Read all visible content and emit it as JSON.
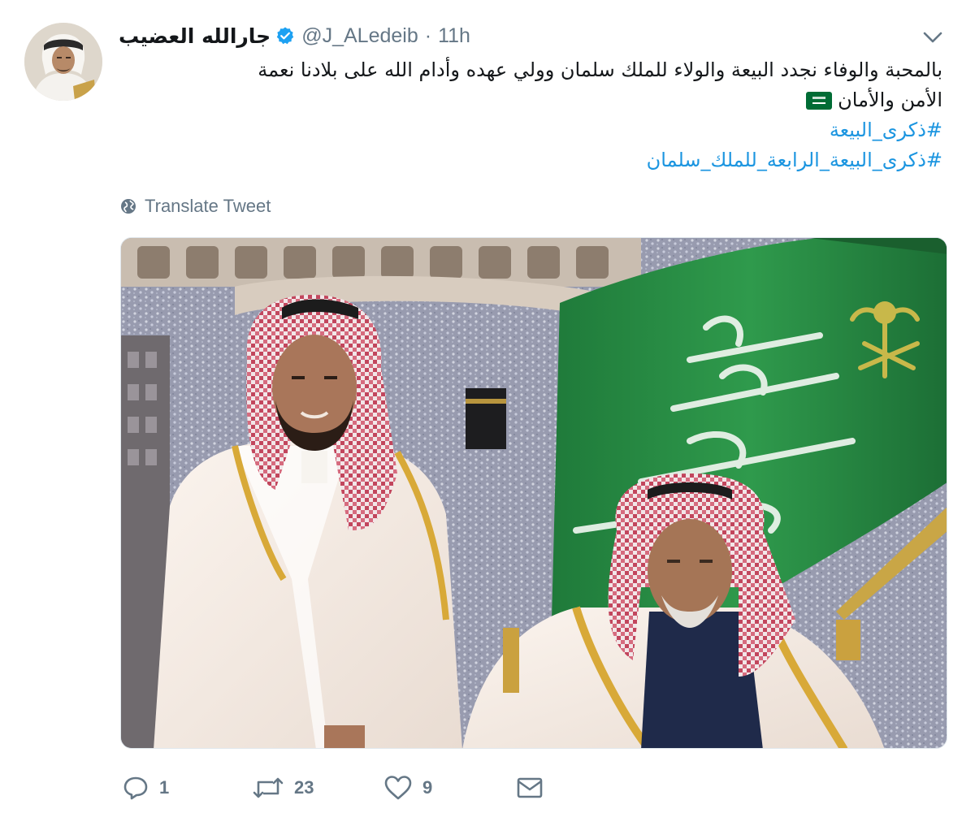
{
  "tweet": {
    "author_name": "جارالله العضيب",
    "handle": "@J_ALedeib",
    "separator": "·",
    "time": "11h",
    "text_line1": "بالمحبة والوفاء نجدد البيعة والولاء للملك سلمان وولي عهده وأدام الله على بلادنا نعمة",
    "text_line2": "الأمن والأمان",
    "hashtag1": "#ذكرى_البيعة",
    "hashtag2": "#ذكرى_البيعة_الرابعة_للملك_سلمان",
    "translate_label": "Translate Tweet",
    "flag_emoji": "saudi-arabia-flag-emoji"
  },
  "stats": {
    "replies": "1",
    "retweets": "23",
    "likes": "9"
  },
  "icons": {
    "verified": "verified-badge-icon",
    "caret": "chevron-down-icon",
    "globe": "globe-icon",
    "reply": "reply-icon",
    "retweet": "retweet-icon",
    "like": "heart-icon",
    "dm": "envelope-icon"
  },
  "colors": {
    "text": "#14171a",
    "secondary": "#657786",
    "link": "#1b95e0",
    "verified": "#1da1f2",
    "flag_green": "#006c35"
  }
}
